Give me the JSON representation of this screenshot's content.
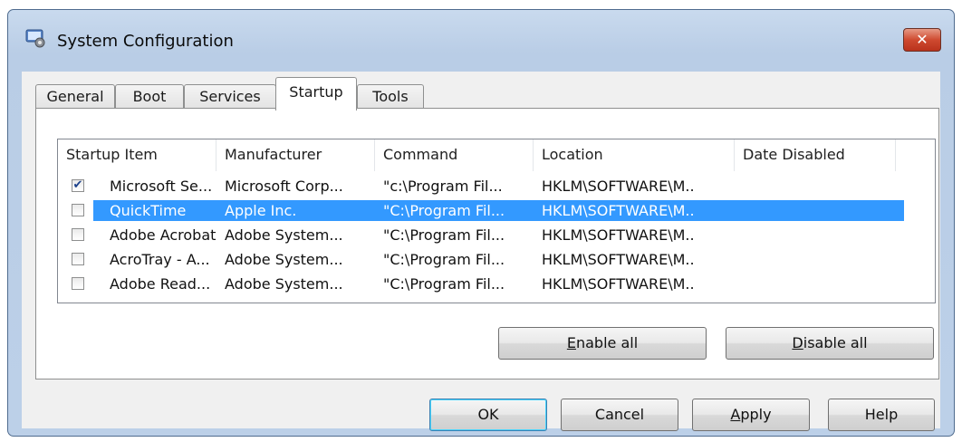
{
  "window": {
    "title": "System Configuration",
    "close_label": "✕"
  },
  "tabs": [
    {
      "label": "General"
    },
    {
      "label": "Boot"
    },
    {
      "label": "Services"
    },
    {
      "label": "Startup",
      "active": true
    },
    {
      "label": "Tools"
    }
  ],
  "startup_list": {
    "columns": [
      "Startup Item",
      "Manufacturer",
      "Command",
      "Location",
      "Date Disabled"
    ],
    "rows": [
      {
        "checked": true,
        "selected": false,
        "item": "Microsoft Se...",
        "manufacturer": "Microsoft Corp...",
        "command": "\"c:\\Program Fil...",
        "location": "HKLM\\SOFTWARE\\M...",
        "date_disabled": ""
      },
      {
        "checked": false,
        "selected": true,
        "item": "QuickTime",
        "manufacturer": "Apple Inc.",
        "command": "\"C:\\Program Fil...",
        "location": "HKLM\\SOFTWARE\\M...",
        "date_disabled": ""
      },
      {
        "checked": false,
        "selected": false,
        "item": "Adobe Acrobat",
        "manufacturer": "Adobe System...",
        "command": "\"C:\\Program Fil...",
        "location": "HKLM\\SOFTWARE\\M...",
        "date_disabled": ""
      },
      {
        "checked": false,
        "selected": false,
        "item": "AcroTray - A...",
        "manufacturer": "Adobe System...",
        "command": "\"C:\\Program Fil...",
        "location": "HKLM\\SOFTWARE\\M...",
        "date_disabled": ""
      },
      {
        "checked": false,
        "selected": false,
        "item": "Adobe Read...",
        "manufacturer": "Adobe System...",
        "command": "\"C:\\Program Fil...",
        "location": "HKLM\\SOFTWARE\\M...",
        "date_disabled": ""
      }
    ]
  },
  "panel_buttons": {
    "enable_all": {
      "mnemonic": "E",
      "rest": "nable all"
    },
    "disable_all": {
      "mnemonic": "D",
      "rest": "isable all"
    }
  },
  "dialog_buttons": {
    "ok": "OK",
    "cancel": "Cancel",
    "apply": {
      "mnemonic": "A",
      "rest": "pply"
    },
    "help": "Help"
  },
  "colors": {
    "selection": "#3399ff",
    "title_bar": "#c9daee",
    "close_button": "#cf4a30"
  }
}
